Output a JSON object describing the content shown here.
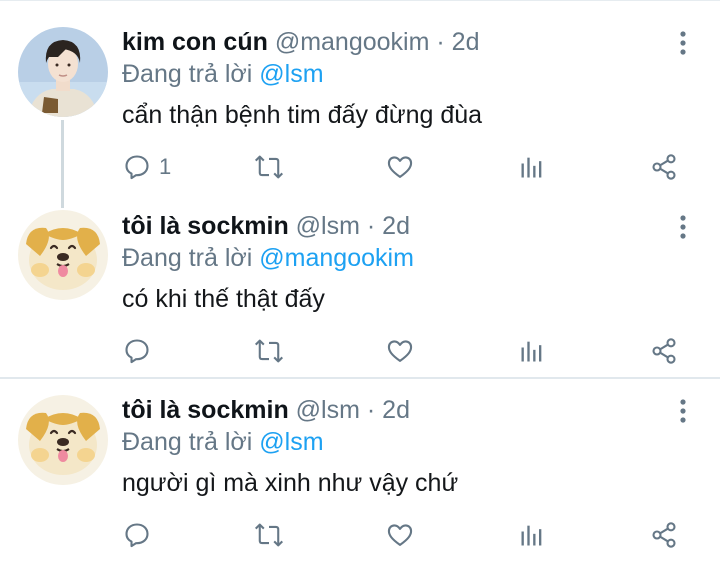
{
  "tweets": [
    {
      "name": "kim con cún",
      "handle": "@mangookim",
      "dot": "·",
      "time": "2d",
      "reply_prefix": "Đang trả lời",
      "reply_to": "@lsm",
      "text": "cẩn thận bệnh tim đấy đừng đùa",
      "reply_count": "1",
      "avatar": "person-avatar"
    },
    {
      "name": "tôi là sockmin",
      "handle": "@lsm",
      "dot": "·",
      "time": "2d",
      "reply_prefix": "Đang trả lời",
      "reply_to": "@mangookim",
      "text": "có khi thế thật đấy",
      "reply_count": "",
      "avatar": "dog-avatar"
    },
    {
      "name": "tôi là sockmin",
      "handle": "@lsm",
      "dot": "·",
      "time": "2d",
      "reply_prefix": "Đang trả lời",
      "reply_to": "@lsm",
      "text": "người gì mà xinh như vậy chứ",
      "reply_count": "",
      "avatar": "dog-avatar"
    }
  ],
  "icons": {
    "reply": "reply-icon",
    "retweet": "retweet-icon",
    "like": "heart-icon",
    "analytics": "analytics-icon",
    "share": "share-icon",
    "more": "more-vertical-icon"
  },
  "colors": {
    "name": "#0f1419",
    "secondary": "#657786",
    "mention": "#1da1f2",
    "divider": "#e1e8ed"
  }
}
